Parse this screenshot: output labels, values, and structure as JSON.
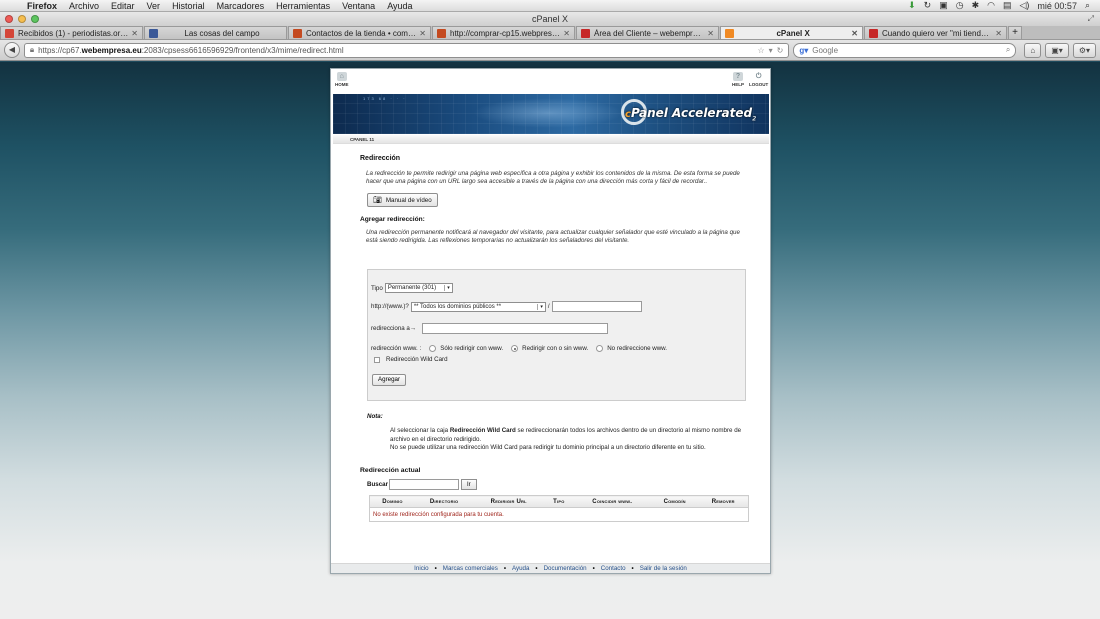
{
  "menubar": {
    "apple": "",
    "items": [
      "Firefox",
      "Archivo",
      "Editar",
      "Ver",
      "Historial",
      "Marcadores",
      "Herramientas",
      "Ventana",
      "Ayuda"
    ],
    "clock": "mié 00:57"
  },
  "window": {
    "title": "cPanel X"
  },
  "tabs": [
    {
      "label": "Recibidos (1) - periodistas.org...",
      "favicon_color": "#d44638"
    },
    {
      "label": "Las cosas del campo",
      "favicon_color": "#3b5998"
    },
    {
      "label": "Contactos de la tienda • compr...",
      "favicon_color": "#c44a20"
    },
    {
      "label": "http://comprar-cp15.webprest...",
      "favicon_color": "#c44a20"
    },
    {
      "label": "Área del Cliente – webempresa...",
      "favicon_color": "#c62828"
    },
    {
      "label": "cPanel X",
      "favicon_color": "#f08a24"
    },
    {
      "label": "Cuando quiero ver \"mi tienda\" ...",
      "favicon_color": "#c62828"
    }
  ],
  "navbar": {
    "url_prefix": "https://cp67.",
    "url_domain": "webempresa.eu",
    "url_rest": ":2083/cpsess6616596929/frontend/x3/mime/redirect.html",
    "search_engine": "Google",
    "search_placeholder": "Google"
  },
  "cpanel": {
    "home_label": "HOME",
    "help_label": "HELP",
    "logout_label": "LOGOUT",
    "banner_brand_c": "c",
    "banner_brand": "Panel Accelerated",
    "banner_sub": "2",
    "breadcrumb": "CPANEL 11"
  },
  "page": {
    "title": "Redirección",
    "description": "La redirección te permite redirigir una página web específica a otra página y exhibir los contenidos de la misma. De esta forma se puede hacer que una página con un URL largo sea accesible a través de la página con una dirección más corta y fácil de recordar..",
    "video_button": "Manual de vídeo",
    "add_title": "Agregar redirección:",
    "add_description": "Una redirección permanente notificará al navegador del visitante, para actualizar cualquier señalador que esté vinculado a la página que está siendo redirigida. Las reflexiones temporarias no actualizarán los señaladores del visitante.",
    "form": {
      "tipo_label": "Tipo",
      "tipo_value": "Permanente (301)",
      "http_label": "http://(www.)?",
      "domain_value": "** Todos los dominios públicos **",
      "slash": "/",
      "path_value": "",
      "redirect_to_label": "redirecciona a→",
      "redirect_to_value": "",
      "www_label": "redirección www. :",
      "www_options": [
        "Sólo redirigir con www.",
        "Redirigir con o sin www.",
        "No redireccione www."
      ],
      "www_selected_index": 1,
      "wildcard_label": "Redirección Wild Card",
      "wildcard_checked": false,
      "submit_label": "Agregar"
    },
    "note_title": "Nota:",
    "note_line1_pre": "Al seleccionar la caja ",
    "note_line1_bold": "Redirección Wild Card",
    "note_line1_post": " se redireccionarán todos los archivos dentro de un directorio al mismo nombre de archivo en el directorio redirigido.",
    "note_line2": "No se puede utilizar una redirección Wild Card para redirigir tu dominio principal a un directorio diferente en tu sitio.",
    "current_title": "Redirección actual",
    "search_label": "Buscar",
    "search_value": "",
    "search_button": "Ir",
    "table_headers": [
      "Dominio",
      "Directorio",
      "Redirigir Url",
      "Tipo",
      "Coincidir www.",
      "Comodín",
      "Remover"
    ],
    "table_empty": "No existe redirección configurada para tu cuenta."
  },
  "footer": {
    "links": [
      "Inicio",
      "Marcas comerciales",
      "Ayuda",
      "Documentación",
      "Contacto",
      "Salir de la sesión"
    ]
  }
}
